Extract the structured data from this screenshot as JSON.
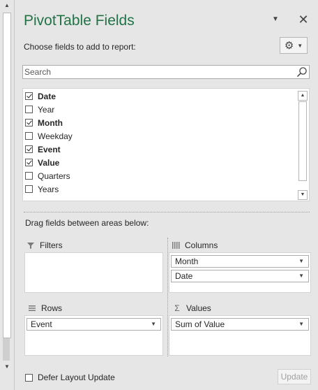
{
  "header": {
    "title": "PivotTable Fields",
    "subtitle": "Choose fields to add to report:"
  },
  "search": {
    "placeholder": "Search",
    "value": ""
  },
  "fields": [
    {
      "label": "Date",
      "checked": true
    },
    {
      "label": "Year",
      "checked": false
    },
    {
      "label": "Month",
      "checked": true
    },
    {
      "label": "Weekday",
      "checked": false
    },
    {
      "label": "Event",
      "checked": true
    },
    {
      "label": "Value",
      "checked": true
    },
    {
      "label": "Quarters",
      "checked": false
    },
    {
      "label": "Years",
      "checked": false
    }
  ],
  "areas": {
    "instruction": "Drag fields between areas below:",
    "filters": {
      "label": "Filters",
      "items": []
    },
    "columns": {
      "label": "Columns",
      "items": [
        "Month",
        "Date"
      ]
    },
    "rows": {
      "label": "Rows",
      "items": [
        "Event"
      ]
    },
    "values": {
      "label": "Values",
      "items": [
        "Sum of Value"
      ]
    }
  },
  "footer": {
    "defer_label": "Defer Layout Update",
    "defer_checked": false,
    "update_label": "Update"
  },
  "colors": {
    "title": "#217346",
    "background": "#e6e6e6"
  },
  "icons": {
    "title_dropdown": "chevron-down-icon",
    "close": "close-icon",
    "settings": "gear-icon",
    "search": "search-icon",
    "filters": "filter-icon",
    "columns": "columns-icon",
    "rows": "rows-icon",
    "values": "sigma-icon"
  }
}
